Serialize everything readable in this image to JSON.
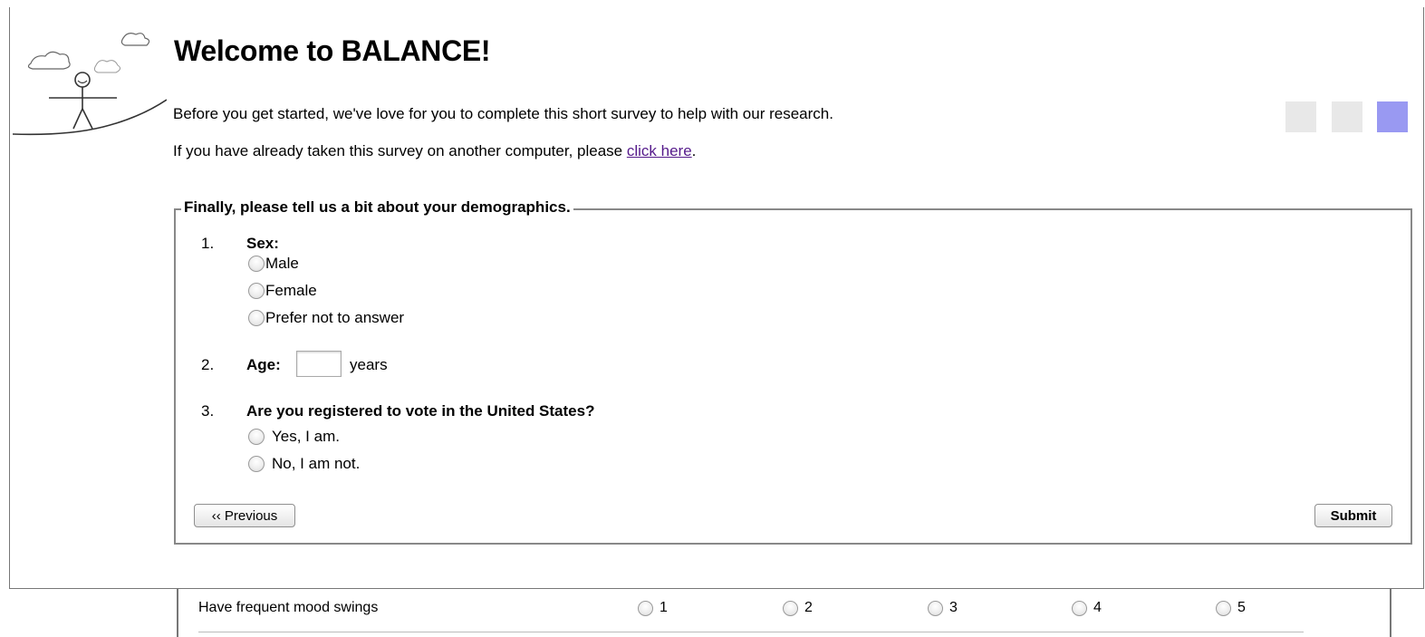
{
  "header": {
    "title": "Welcome to BALANCE!",
    "intro": "Before you get started, we've love for you to complete this short survey to help with our research.",
    "already_prefix": "If you have already taken this survey on another computer, please ",
    "already_link": "click here",
    "already_suffix": "."
  },
  "progress_colors": [
    "#e8e8e8",
    "#e8e8e8",
    "#9999f2"
  ],
  "section": {
    "legend": "Finally, please tell us a bit about your demographics.",
    "questions": [
      {
        "number": "1.",
        "label": "Sex:",
        "options": [
          "Male",
          "Female",
          "Prefer not to answer"
        ]
      },
      {
        "number": "2.",
        "label": "Age:",
        "unit": "years",
        "value": ""
      },
      {
        "number": "3.",
        "label": "Are you registered to vote in the United States?",
        "options": [
          "Yes, I am.",
          "No, I am not."
        ]
      }
    ],
    "prev_label": "‹‹ Previous",
    "submit_label": "Submit"
  },
  "underlay": {
    "item": "Have frequent mood swings",
    "scale": [
      "1",
      "2",
      "3",
      "4",
      "5"
    ]
  }
}
